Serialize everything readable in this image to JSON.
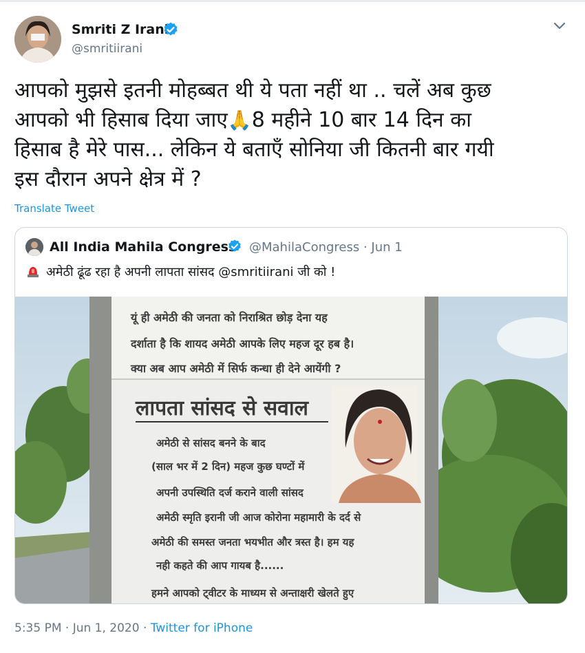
{
  "tweet": {
    "author_name": "Smriti Z Irani",
    "author_handle": "@smritiirani",
    "body_line1": "आपको मुझसे इतनी मोहब्बत थी ये पता नहीं था .. चलें अब कुछ",
    "body_line2a": "आपको भी हिसाब दिया जाए",
    "emoji": "🙏",
    "body_line2b": "8 महीने 10 बार 14 दिन का",
    "body_line3": "हिसाब है मेरे पास... लेकिन ये बताएँ सोनिया जी कितनी बार गयी",
    "body_line4": "इस दौरान अपने क्षेत्र में ?",
    "translate_label": "Translate Tweet",
    "timestamp": "5:35 PM · Jun 1, 2020",
    "separator": " · ",
    "source": "Twitter for iPhone"
  },
  "quoted": {
    "author_name": "All India Mahila Congress",
    "author_handle_date": "@MahilaCongress · Jun 1",
    "text": "अमेठी ढूंढ रहा है अपनी लापता सांसद @smritiirani जी को !",
    "poster": {
      "top_line1": "यूं ही अमेठी की जनता को निराश्रित छोड़ देना यह",
      "top_line2": "दर्शाता है कि शायद अमेठी आपके लिए महज दूर हब है।",
      "top_line3": "क्या अब आप अमेठी में सिर्फ कन्धा ही देने आयेंगी ?",
      "heading": "लापता सांसद से सवाल",
      "line1": "अमेठी से सांसद बनने के बाद",
      "line2": "(साल भर में 2 दिन) महज कुछ घण्टों में",
      "line3": "अपनी उपस्थिति दर्ज कराने वाली सांसद",
      "line4": "अमेठी स्मृति इरानी जी आज कोरोना महामारी के दर्द से",
      "line5": "अमेठी की समस्त जनता भयभीत और त्रस्त है। हम यह",
      "line6": "नही कहते की आप गायब है......",
      "line7": "हमने आपको ट्वीटर के माध्यम से अन्ताक्षरी खेलते हुए"
    }
  },
  "icons": {
    "verified": "verified-badge-icon",
    "caret": "chevron-down-icon",
    "siren": "rotating-light-icon"
  },
  "colors": {
    "link": "#1b95e0",
    "secondary_text": "#657786",
    "verified": "#1da1f2",
    "border": "#ccd6dd"
  }
}
